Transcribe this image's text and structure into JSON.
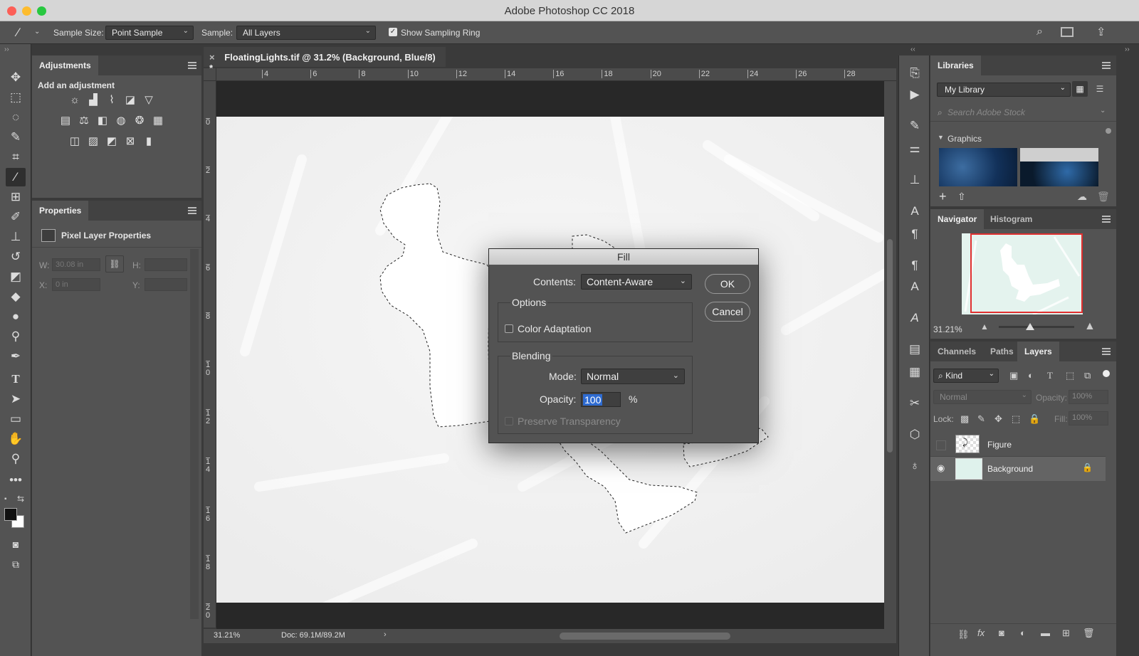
{
  "window": {
    "title": "Adobe Photoshop CC 2018"
  },
  "options_bar": {
    "sample_size_label": "Sample Size:",
    "sample_size_value": "Point Sample",
    "sample_label": "Sample:",
    "sample_value": "All Layers",
    "show_sampling_ring_label": "Show Sampling Ring",
    "show_sampling_ring_checked": true
  },
  "document": {
    "tab_title": "FloatingLights.tif @ 31.2% (Background, Blue/8) *",
    "ruler_top": [
      "4",
      "6",
      "8",
      "10",
      "12",
      "14",
      "16",
      "18",
      "20",
      "22",
      "24",
      "26",
      "28"
    ],
    "ruler_left": [
      "0",
      "2",
      "4",
      "6",
      "8",
      "1\n0",
      "1\n2",
      "1\n4",
      "1\n6",
      "1\n8",
      "2\n0"
    ],
    "zoom": "31.21%",
    "doc_info": "Doc: 69.1M/89.2M"
  },
  "adjustments": {
    "tab": "Adjustments",
    "subtitle": "Add an adjustment"
  },
  "properties": {
    "tab": "Properties",
    "subtitle": "Pixel Layer Properties",
    "w_label": "W:",
    "w_value": "30.08 in",
    "h_label": "H:",
    "x_label": "X:",
    "x_value": "0 in",
    "y_label": "Y:"
  },
  "fill_dialog": {
    "title": "Fill",
    "contents_label": "Contents:",
    "contents_value": "Content-Aware",
    "options_title": "Options",
    "color_adaptation_label": "Color Adaptation",
    "blending_title": "Blending",
    "mode_label": "Mode:",
    "mode_value": "Normal",
    "opacity_label": "Opacity:",
    "opacity_value": "100",
    "opacity_unit": "%",
    "preserve_transparency_label": "Preserve Transparency",
    "ok_label": "OK",
    "cancel_label": "Cancel"
  },
  "libraries": {
    "tab": "Libraries",
    "library_select": "My Library",
    "search_placeholder": "Search Adobe Stock",
    "section": "Graphics"
  },
  "navigator": {
    "tab_navigator": "Navigator",
    "tab_histogram": "Histogram",
    "zoom": "31.21%"
  },
  "layers": {
    "tab_channels": "Channels",
    "tab_paths": "Paths",
    "tab_layers": "Layers",
    "filter_kind": "Kind",
    "blend_mode": "Normal",
    "opacity_label": "Opacity:",
    "opacity_value": "100%",
    "lock_label": "Lock:",
    "fill_label": "Fill:",
    "fill_value": "100%",
    "items": [
      {
        "name": "Figure",
        "visible": false
      },
      {
        "name": "Background",
        "visible": true,
        "locked": true
      }
    ]
  },
  "colors": {
    "panel_bg": "#535353",
    "selection_highlight": "#2e6bd1",
    "navigator_frame": "#e03030"
  }
}
